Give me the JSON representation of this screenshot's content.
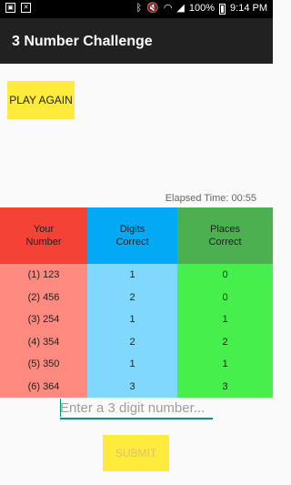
{
  "status_bar": {
    "battery": "100%",
    "time": "9:14 PM",
    "icons": [
      "image-icon",
      "close-box-icon",
      "bluetooth-icon",
      "mute-icon",
      "wifi-icon",
      "signal-icon",
      "battery-icon"
    ]
  },
  "app": {
    "title": "3 Number Challenge"
  },
  "buttons": {
    "play_again": "PLAY AGAIN",
    "submit": "SUBMIT"
  },
  "elapsed": "Elapsed Time: 00:55",
  "table": {
    "headers": [
      {
        "line1": "Your",
        "line2": "Number"
      },
      {
        "line1": "Digits",
        "line2": "Correct"
      },
      {
        "line1": "Places",
        "line2": "Correct"
      }
    ],
    "rows": [
      {
        "number": "(1) 123",
        "digits": "1",
        "places": "0"
      },
      {
        "number": "(2) 456",
        "digits": "2",
        "places": "0"
      },
      {
        "number": "(3) 254",
        "digits": "1",
        "places": "1"
      },
      {
        "number": "(4) 354",
        "digits": "2",
        "places": "2"
      },
      {
        "number": "(5) 350",
        "digits": "1",
        "places": "1"
      },
      {
        "number": "(6) 364",
        "digits": "3",
        "places": "3"
      }
    ]
  },
  "input": {
    "value": "",
    "placeholder": "Enter a 3 digit number..."
  },
  "colors": {
    "header_your_number": "#f44336",
    "header_digits": "#03a9f4",
    "header_places": "#4caf50",
    "button_yellow": "#ffeb3b",
    "accent": "#009688"
  }
}
